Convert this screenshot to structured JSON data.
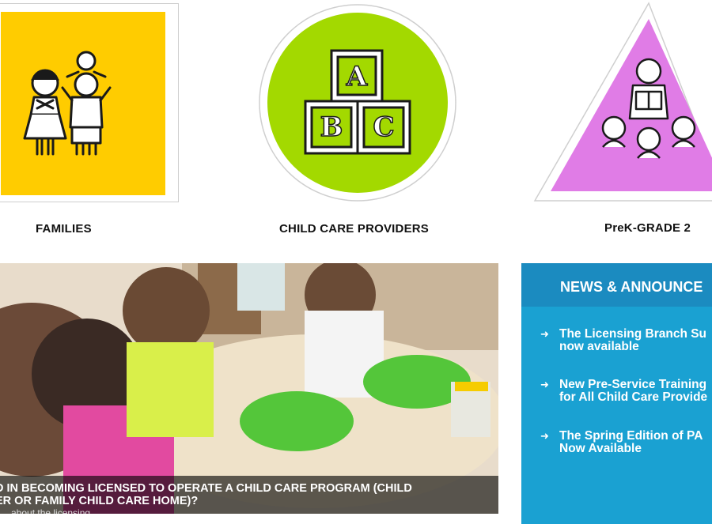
{
  "categories": [
    {
      "label": "FAMILIES",
      "icon": "family-icon",
      "color": "#ffcc00"
    },
    {
      "label": "CHILD CARE PROVIDERS",
      "icon": "abc-blocks-icon",
      "color": "#a3d900"
    },
    {
      "label": "PreK-GRADE 2",
      "icon": "reading-teacher-icon",
      "color": "#e07ce6"
    }
  ],
  "hero": {
    "caption_line1": "D IN BECOMING LICENSED TO OPERATE A CHILD CARE PROGRAM (CHILD",
    "caption_line2": "ER OR FAMILY CHILD CARE HOME)?",
    "caption_line3": "...about the licensing"
  },
  "news": {
    "title": "NEWS & ANNOUNCE",
    "items": [
      {
        "line1": "The Licensing Branch Su",
        "line2": "now available"
      },
      {
        "line1": "New Pre-Service Training",
        "line2": "for All Child Care Provide"
      },
      {
        "line1": "The Spring Edition of PA",
        "line2": "Now Available"
      }
    ]
  }
}
